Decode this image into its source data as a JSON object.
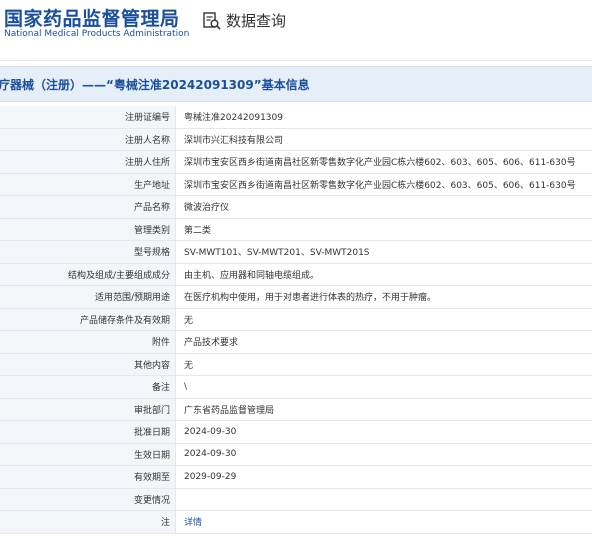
{
  "header": {
    "logo_cn": "国家药品监督管理局",
    "logo_en": "National Medical Products Administration",
    "section_title": "数据查询",
    "section_icon": "search-document-icon"
  },
  "page": {
    "title": "疗器械（注册）——“粤械注准20242091309”基本信息"
  },
  "rows": [
    {
      "label": "注册证编号",
      "value": "粤械注准20242091309"
    },
    {
      "label": "注册人名称",
      "value": "深圳市兴汇科技有限公司"
    },
    {
      "label": "注册人住所",
      "value": "深圳市宝安区西乡街道南昌社区新零售数字化产业园C栋六楼602、603、605、606、611-630号"
    },
    {
      "label": "生产地址",
      "value": "深圳市宝安区西乡街道南昌社区新零售数字化产业园C栋六楼602、603、605、606、611-630号"
    },
    {
      "label": "产品名称",
      "value": "微波治疗仪"
    },
    {
      "label": "管理类别",
      "value": "第二类"
    },
    {
      "label": "型号规格",
      "value": "SV-MWT101、SV-MWT201、SV-MWT201S"
    },
    {
      "label": "结构及组成/主要组成成分",
      "value": "由主机、应用器和同轴电缆组成。"
    },
    {
      "label": "适用范围/预期用途",
      "value": "在医疗机构中使用，用于对患者进行体表的热疗，不用于肿瘤。"
    },
    {
      "label": "产品储存条件及有效期",
      "value": "无"
    },
    {
      "label": "附件",
      "value": "产品技术要求"
    },
    {
      "label": "其他内容",
      "value": "无"
    },
    {
      "label": "备注",
      "value": "\\"
    },
    {
      "label": "审批部门",
      "value": "广东省药品监督管理局"
    },
    {
      "label": "批准日期",
      "value": "2024-09-30"
    },
    {
      "label": "生效日期",
      "value": "2024-09-30"
    },
    {
      "label": "有效期至",
      "value": "2029-09-29"
    },
    {
      "label": "变更情况",
      "value": ""
    },
    {
      "label": "注",
      "value": "详情",
      "is_link": true
    }
  ],
  "colors": {
    "brand": "#1a4f9c",
    "title_bg": "#e6eef7",
    "label_bg": "#f3f5f8"
  }
}
